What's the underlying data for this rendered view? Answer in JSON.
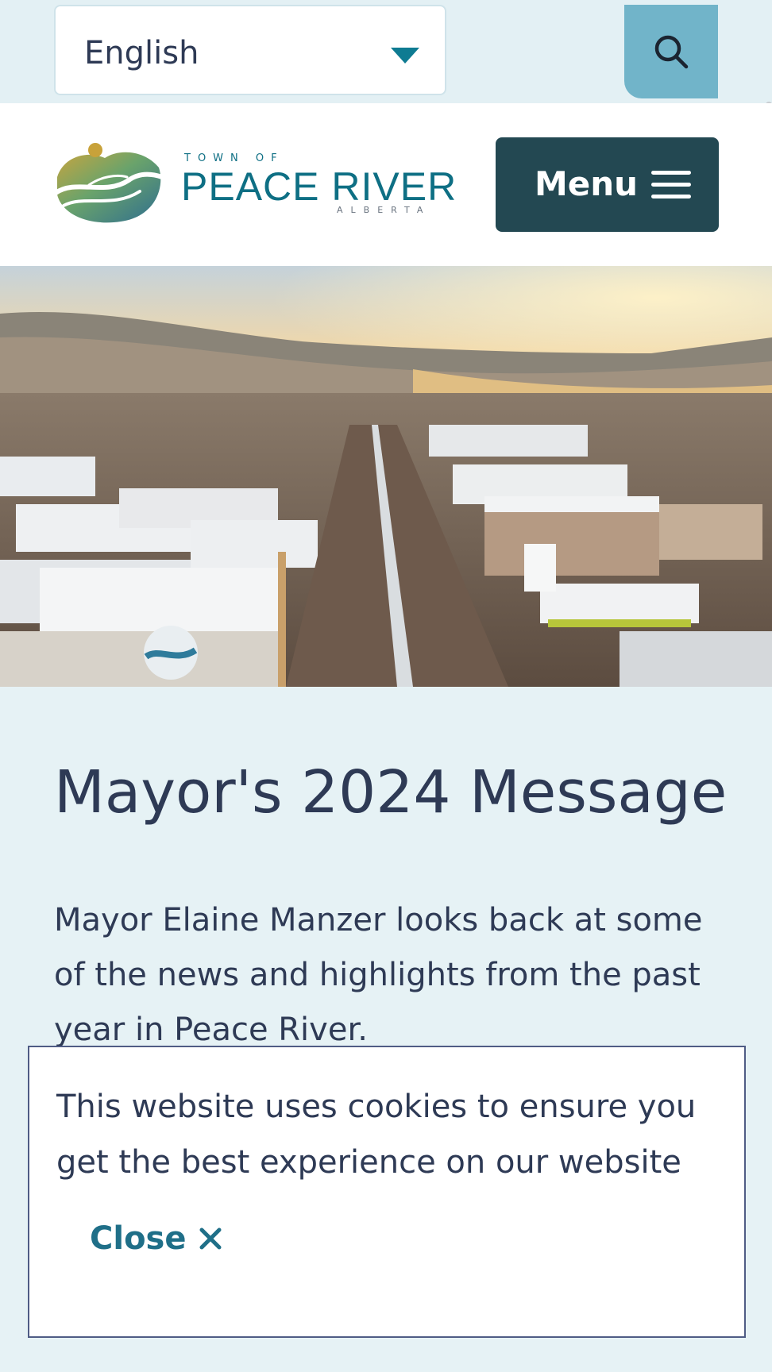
{
  "top_bar": {
    "language": "English"
  },
  "header": {
    "logo": {
      "small_text": "TOWN OF",
      "name": "PEACE RIVER",
      "region": "ALBERTA"
    },
    "menu_label": "Menu"
  },
  "article": {
    "title": "Mayor's 2024 Message",
    "summary": "Mayor Elaine Manzer looks back at some of the news and highlights from the past year in Peace River."
  },
  "cookie_banner": {
    "message": "This website uses cookies to ensure you get the best experience on our website",
    "close_label": "Close",
    "close_icon": "close-icon"
  },
  "colors": {
    "accent_teal": "#0e7b92",
    "menu_bg": "#234852",
    "search_bg": "#71b4c9",
    "page_bg": "#e6f2f5",
    "text": "#2e3a55"
  }
}
